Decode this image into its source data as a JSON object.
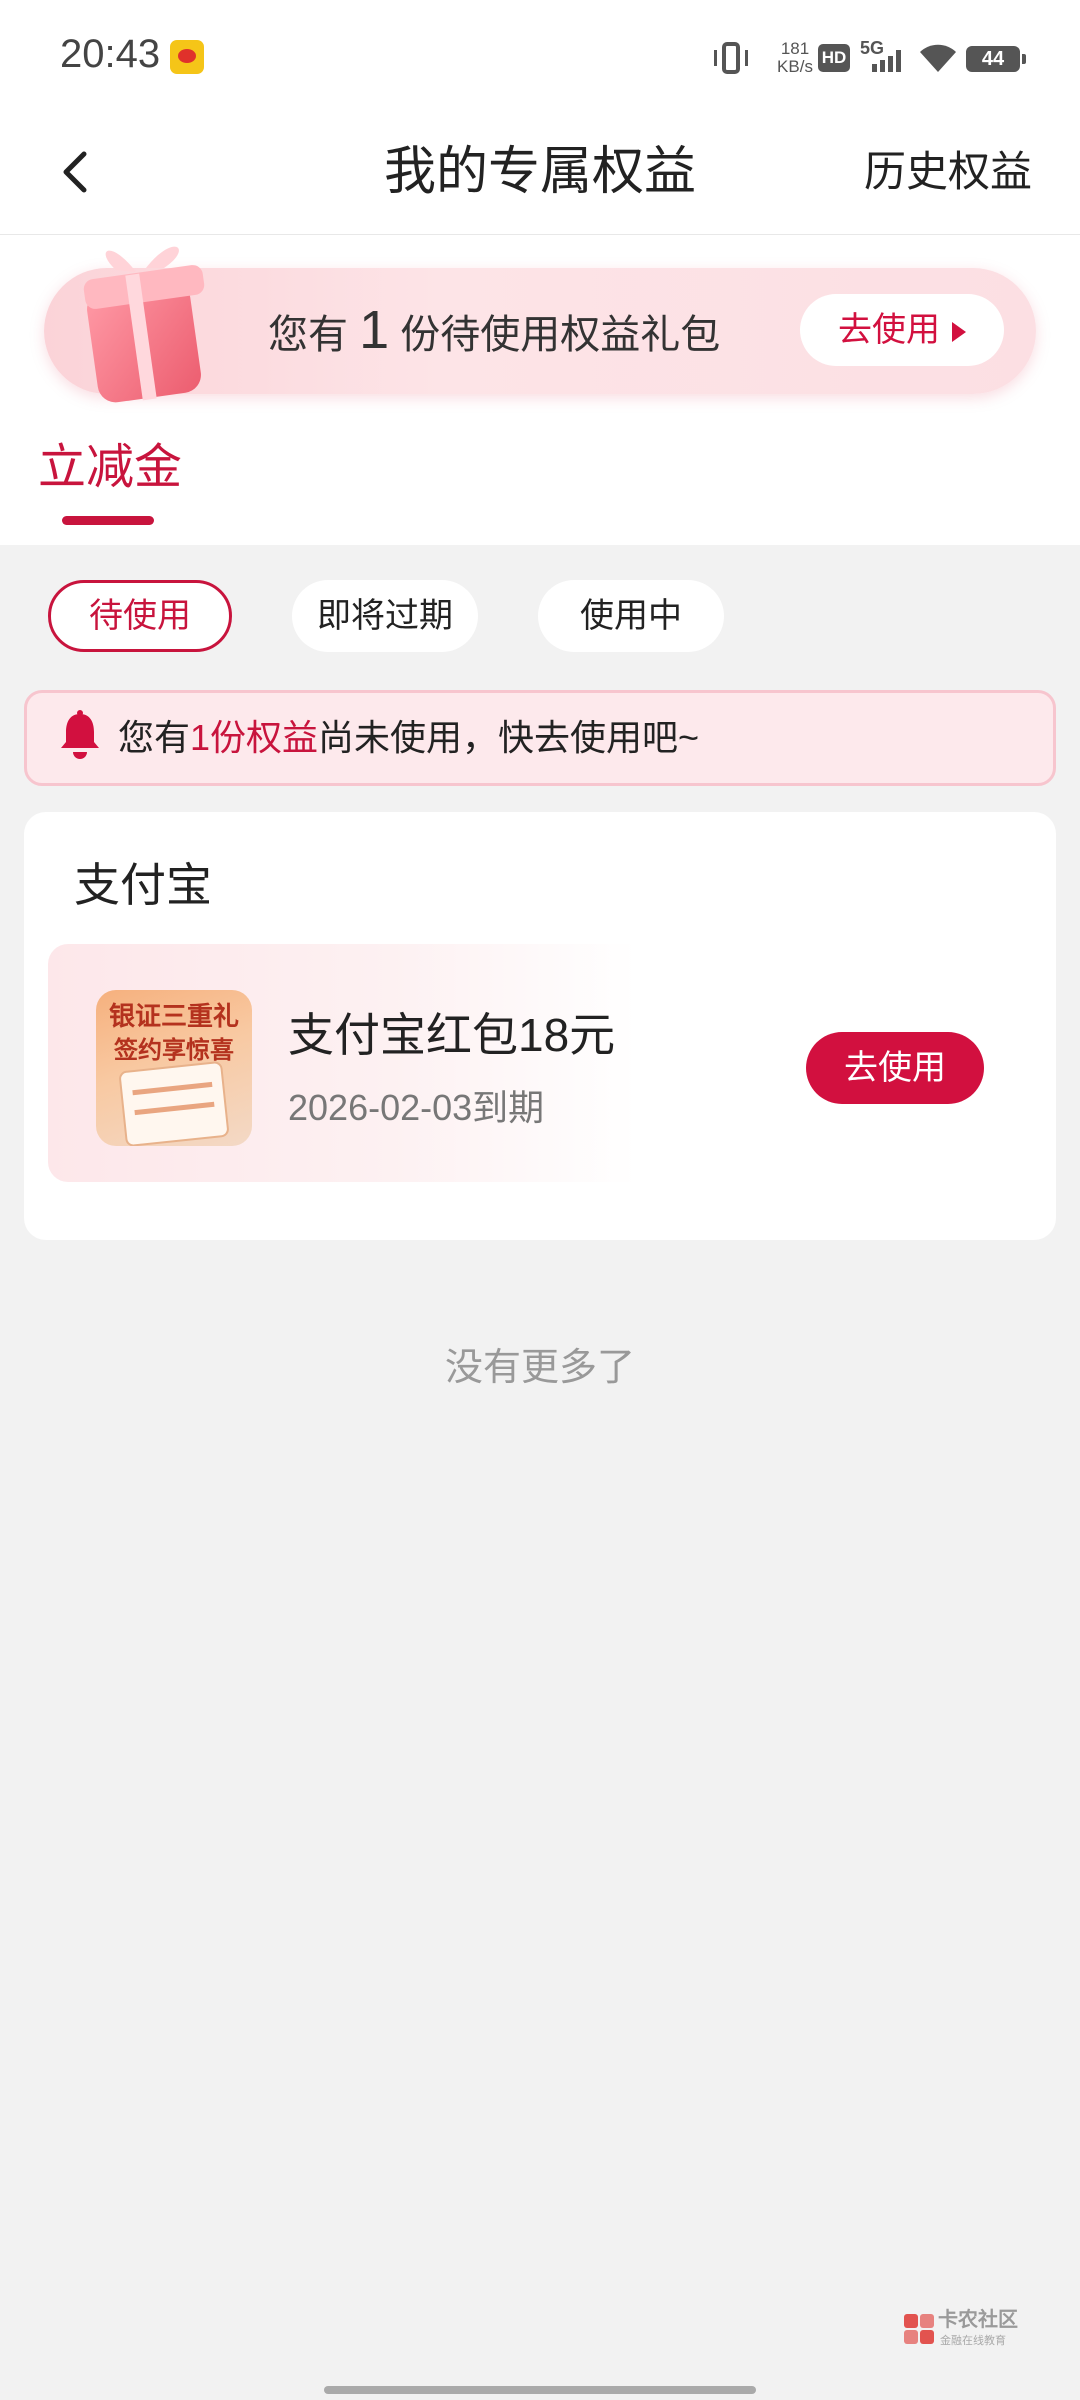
{
  "status_bar": {
    "time": "20:43",
    "net_speed_value": "181",
    "net_speed_unit": "KB/s",
    "hd": "HD",
    "network": "5G",
    "battery": "44"
  },
  "header": {
    "title": "我的专属权益",
    "history_link": "历史权益"
  },
  "banner": {
    "text_before": "您有",
    "count": "1",
    "text_after": "份待使用权益礼包",
    "button_label": "去使用"
  },
  "tabs": [
    {
      "label": "立减金",
      "active": true
    }
  ],
  "filters": [
    {
      "label": "待使用",
      "active": true
    },
    {
      "label": "即将过期",
      "active": false
    },
    {
      "label": "使用中",
      "active": false
    }
  ],
  "notice": {
    "prefix": "您有",
    "highlight": "1份权益",
    "suffix": "尚未使用，快去使用吧~"
  },
  "section": {
    "title": "支付宝",
    "coupon": {
      "thumb_line1": "银证三重礼",
      "thumb_line2": "签约享惊喜",
      "name": "支付宝红包18元",
      "expiry": "2026-02-03到期",
      "button_label": "去使用"
    }
  },
  "footer": {
    "no_more": "没有更多了"
  },
  "watermark": {
    "title": "卡农社区",
    "subtitle": "金融在线教育"
  },
  "colors": {
    "accent": "#c8143d",
    "button": "#d2103f",
    "notice_bg": "#fde9ec",
    "page_bg": "#f2f2f2"
  }
}
